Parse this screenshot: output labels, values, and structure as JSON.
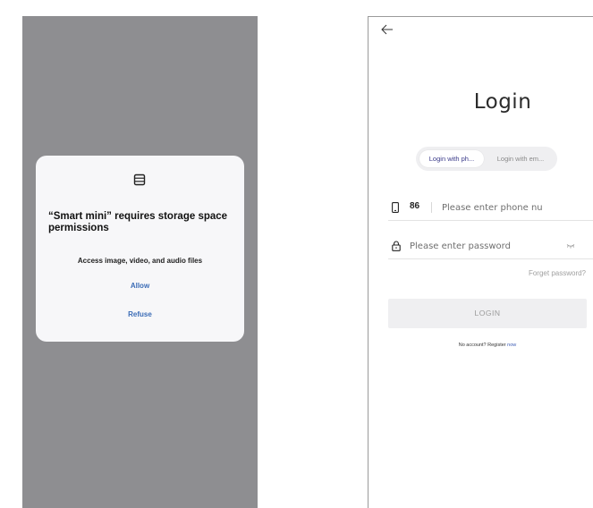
{
  "permission_dialog": {
    "icon": "storage-icon",
    "title": "“Smart mini” requires storage space permissions",
    "description": "Access image, video, and audio files",
    "allow_label": "Allow",
    "refuse_label": "Refuse",
    "backdrop_color": "#8e8e91",
    "button_color": "#3b6cb6"
  },
  "login_screen": {
    "back_icon": "back-arrow-icon",
    "title": "Login",
    "tabs": [
      {
        "label": "Login with ph...",
        "selected": true
      },
      {
        "label": "Login with em...",
        "selected": false
      }
    ],
    "phone": {
      "icon": "phone-icon",
      "country_code": "86",
      "placeholder": "Please enter phone nu",
      "value": ""
    },
    "password": {
      "icon": "lock-icon",
      "placeholder": "Please enter password",
      "value": "",
      "toggle_icon": "eye-closed-icon"
    },
    "forget_password": "Forget password?",
    "login_button": "LOGIN",
    "register_prompt": "No account? Register ",
    "register_link": "now",
    "accent_color": "#3b5bb5"
  }
}
